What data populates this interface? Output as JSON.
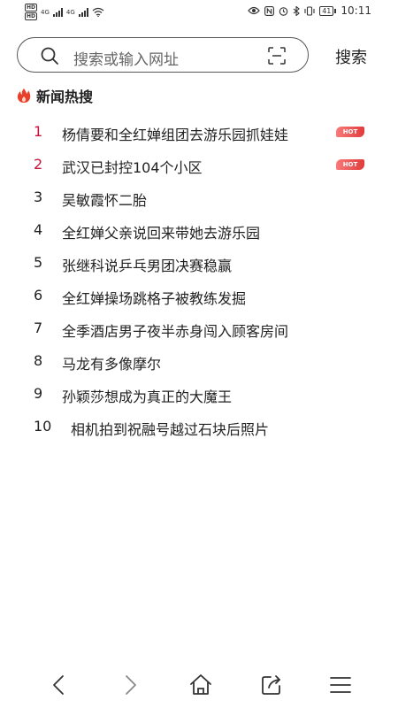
{
  "status_bar": {
    "sim1": "HD",
    "sim2": "HD",
    "net1": "4G",
    "net2": "4G",
    "battery": "41",
    "time": "10:11"
  },
  "search": {
    "placeholder": "搜索或输入网址",
    "button_label": "搜索"
  },
  "section": {
    "title": "新闻热搜"
  },
  "news": [
    {
      "rank": "1",
      "title": "杨倩要和全红婵组团去游乐园抓娃娃",
      "badge": "HOT"
    },
    {
      "rank": "2",
      "title": "武汉已封控104个小区",
      "badge": "HOT"
    },
    {
      "rank": "3",
      "title": "吴敏霞怀二胎",
      "badge": ""
    },
    {
      "rank": "4",
      "title": "全红婵父亲说回来带她去游乐园",
      "badge": ""
    },
    {
      "rank": "5",
      "title": "张继科说乒乓男团决赛稳赢",
      "badge": ""
    },
    {
      "rank": "6",
      "title": "全红婵操场跳格子被教练发掘",
      "badge": ""
    },
    {
      "rank": "7",
      "title": "全季酒店男子夜半赤身闯入顾客房间",
      "badge": ""
    },
    {
      "rank": "8",
      "title": "马龙有多像摩尔",
      "badge": ""
    },
    {
      "rank": "9",
      "title": "孙颖莎想成为真正的大魔王",
      "badge": ""
    },
    {
      "rank": "10",
      "title": "相机拍到祝融号越过石块后照片",
      "badge": ""
    }
  ],
  "colors": {
    "accent_rank": "#c8123a",
    "hot_badge": "#e13b3b",
    "fire": "#e8402a"
  },
  "bottom_nav": {
    "icons": [
      "back-icon",
      "forward-icon",
      "home-icon",
      "share-icon",
      "menu-icon"
    ]
  }
}
